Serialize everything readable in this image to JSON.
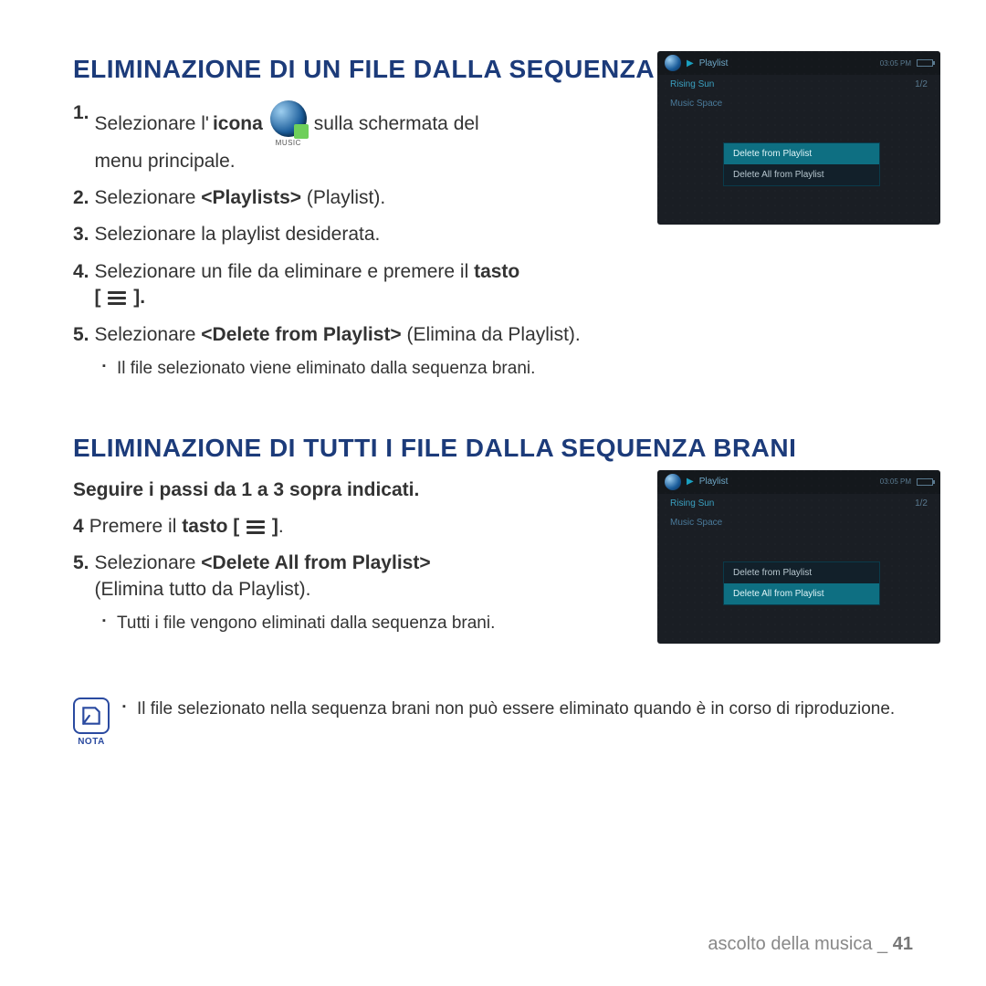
{
  "section1": {
    "heading": "ELIMINAZIONE DI UN FILE DALLA SEQUENZA BRANI",
    "step1_a": "Selezionare l'",
    "step1_icona": "icona",
    "step1_b": "sulla schermata del",
    "step1_c": "menu principale.",
    "music_label": "MUSIC",
    "step2_a": "Selezionare ",
    "step2_b": "<Playlists>",
    "step2_c": " (Playlist).",
    "step3": "Selezionare la playlist desiderata.",
    "step4_a": "Selezionare un file da eliminare e premere il ",
    "step4_b": "tasto",
    "step4_c": "[",
    "step4_d": "].",
    "step5_a": "Selezionare ",
    "step5_b": "<Delete from Playlist>",
    "step5_c": " (Elimina da Playlist).",
    "step5_sub": "Il file selezionato viene eliminato dalla sequenza brani."
  },
  "section2": {
    "heading": "ELIMINAZIONE DI TUTTI I FILE DALLA SEQUENZA BRANI",
    "intro": "Seguire i passi da 1 a 3 sopra indicati.",
    "step4_a": "Premere il ",
    "step4_b": "tasto [",
    "step4_c": "]",
    "step4_d": ".",
    "step5_a": "Selezionare ",
    "step5_b": "<Delete All from Playlist>",
    "step5_c": "(Elimina tutto da Playlist).",
    "step5_sub": "Tutti i file vengono eliminati dalla sequenza brani."
  },
  "device": {
    "playlist_label": "Playlist",
    "time": "03:05 PM",
    "count": "1/2",
    "row1": "Rising Sun",
    "row2": "Music Space",
    "menu_item1": "Delete from Playlist",
    "menu_item2": "Delete All from Playlist"
  },
  "note": {
    "label": "NOTA",
    "text": "Il file selezionato nella sequenza brani non può essere eliminato quando è in corso di riproduzione."
  },
  "footer": {
    "section": "ascolto della musica _",
    "page": "41"
  }
}
